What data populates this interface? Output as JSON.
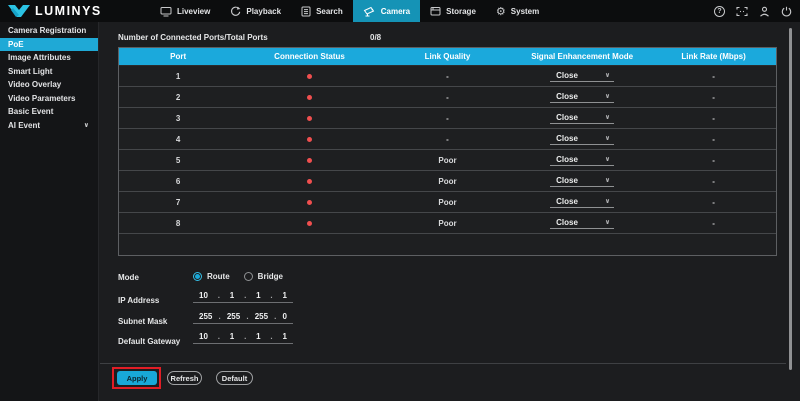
{
  "brand": {
    "name": "LUMINYS"
  },
  "topbar": {
    "tabs": [
      {
        "label": "Liveview",
        "icon": "monitor-icon",
        "active": false
      },
      {
        "label": "Playback",
        "icon": "playback-icon",
        "active": false
      },
      {
        "label": "Search",
        "icon": "search-document-icon",
        "active": false
      },
      {
        "label": "Camera",
        "icon": "camera-icon",
        "active": true
      },
      {
        "label": "Storage",
        "icon": "storage-icon",
        "active": false
      },
      {
        "label": "System",
        "icon": "gear-icon",
        "active": false
      }
    ],
    "right_icons": [
      "help-icon",
      "fullscreen-icon",
      "user-icon",
      "power-icon"
    ],
    "help_glyph": "?",
    "gear_glyph": "⚙"
  },
  "sidebar": {
    "items": [
      {
        "label": "Camera Registration",
        "active": false
      },
      {
        "label": "PoE",
        "active": true
      },
      {
        "label": "Image Attributes",
        "active": false
      },
      {
        "label": "Smart Light",
        "active": false
      },
      {
        "label": "Video Overlay",
        "active": false
      },
      {
        "label": "Video Parameters",
        "active": false
      },
      {
        "label": "Basic Event",
        "active": false
      },
      {
        "label": "AI Event",
        "active": false,
        "expandable": true,
        "chevron": "∨"
      }
    ]
  },
  "main": {
    "summary": {
      "label": "Number of Connected Ports/Total Ports",
      "value": "0/8"
    },
    "table": {
      "columns": [
        "Port",
        "Connection Status",
        "Link Quality",
        "Signal Enhancement Mode",
        "Link Rate (Mbps)"
      ],
      "chevron": "∨",
      "rows": [
        {
          "port": "1",
          "status": "disconnected",
          "link_quality": "-",
          "enhancement_mode": "Close",
          "link_rate": "-"
        },
        {
          "port": "2",
          "status": "disconnected",
          "link_quality": "-",
          "enhancement_mode": "Close",
          "link_rate": "-"
        },
        {
          "port": "3",
          "status": "disconnected",
          "link_quality": "-",
          "enhancement_mode": "Close",
          "link_rate": "-"
        },
        {
          "port": "4",
          "status": "disconnected",
          "link_quality": "-",
          "enhancement_mode": "Close",
          "link_rate": "-"
        },
        {
          "port": "5",
          "status": "disconnected",
          "link_quality": "Poor",
          "enhancement_mode": "Close",
          "link_rate": "-"
        },
        {
          "port": "6",
          "status": "disconnected",
          "link_quality": "Poor",
          "enhancement_mode": "Close",
          "link_rate": "-"
        },
        {
          "port": "7",
          "status": "disconnected",
          "link_quality": "Poor",
          "enhancement_mode": "Close",
          "link_rate": "-"
        },
        {
          "port": "8",
          "status": "disconnected",
          "link_quality": "Poor",
          "enhancement_mode": "Close",
          "link_rate": "-"
        }
      ]
    },
    "form": {
      "separator": ".",
      "mode": {
        "label": "Mode",
        "options": [
          {
            "label": "Route",
            "selected": true
          },
          {
            "label": "Bridge",
            "selected": false
          }
        ]
      },
      "ip_address": {
        "label": "IP Address",
        "octets": [
          "10",
          "1",
          "1",
          "1"
        ]
      },
      "subnet_mask": {
        "label": "Subnet Mask",
        "octets": [
          "255",
          "255",
          "255",
          "0"
        ]
      },
      "default_gateway": {
        "label": "Default Gateway",
        "octets": [
          "10",
          "1",
          "1",
          "1"
        ]
      }
    },
    "buttons": {
      "apply": "Apply",
      "refresh": "Refresh",
      "default": "Default"
    }
  },
  "colors": {
    "accent": "#1ba9dc",
    "tab_active": "#1593b6",
    "sidebar_active": "#1fa9d6",
    "status_offline": "#f04f4f",
    "annotation_red": "#e11d25"
  }
}
